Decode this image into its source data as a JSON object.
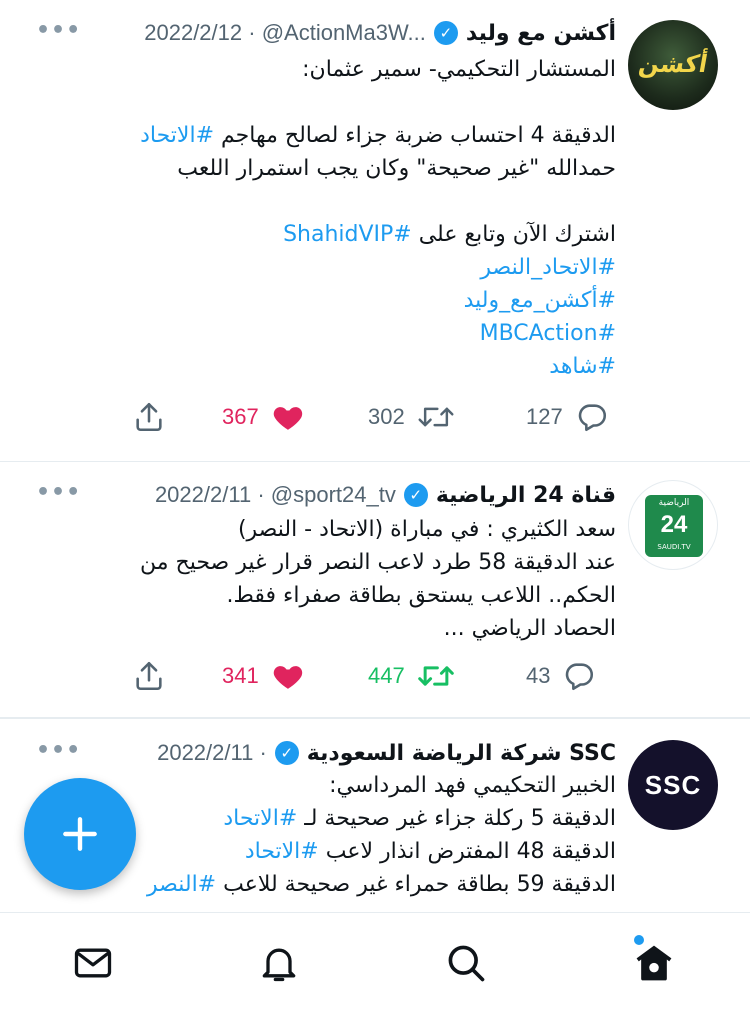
{
  "feed": {
    "tweets": [
      {
        "author": "أكشن مع وليد",
        "handle": "@ActionMa3W...",
        "date": "2022/2/12",
        "separator": "·",
        "more": "•••",
        "body": {
          "l1": "المستشار التحكيمي- سمير عثمان:",
          "l2_text": "الدقيقة 4 احتساب ضربة جزاء لصالح مهاجم",
          "l2_tag": "#الاتحاد",
          "l3": "حمدالله \"غير صحيحة\" وكان يجب استمرار اللعب",
          "l4_text": "اشترك الآن وتابع على",
          "l4_tag": "#ShahidVIP",
          "tag1": "#الاتحاد_النصر",
          "tag2": "#أكشن_مع_وليد",
          "tag3": "#MBCAction",
          "tag4": "#شاهد"
        },
        "stats": {
          "replies": "127",
          "retweets": "302",
          "likes": "367"
        },
        "avatar_logo": "أكشن"
      },
      {
        "author": "قناة 24 الرياضية",
        "handle": "@sport24_tv",
        "date": "2022/2/11",
        "separator": "·",
        "more": "•••",
        "body": {
          "l1": "سعد الكثيري : في مباراة (الاتحاد - النصر)",
          "l2": "عند الدقيقة 58 طرد لاعب النصر قرار غير صحيح من",
          "l3": "الحكم.. اللاعب يستحق بطاقة صفراء فقط.",
          "l4": "الحصاد الرياضي ..."
        },
        "stats": {
          "replies": "43",
          "retweets": "447",
          "likes": "341"
        },
        "avatar_top": "الرياضية",
        "avatar_num": "24",
        "avatar_sub": "SAUDI.TV"
      },
      {
        "author": "شركة الرياضة السعودية SSC",
        "handle": "",
        "date": "2022/2/11",
        "separator": "·",
        "more": "•••",
        "body": {
          "l1": "الخبير التحكيمي فهد المرداسي:",
          "l2_text": "الدقيقة 5 ركلة جزاء غير صحيحة لـ",
          "l2_tag": "#الاتحاد",
          "l3_text": "الدقيقة 48 المفترض انذار لاعب",
          "l3_tag": "#الاتحاد",
          "l4_text": "الدقيقة 59 بطاقة حمراء غير صحيحة للاعب",
          "l4_tag": "#النصر"
        },
        "avatar_logo": "SSC"
      }
    ]
  },
  "icons": {
    "verified": "verified-badge-icon",
    "reply": "reply-icon",
    "retweet": "retweet-icon",
    "like": "heart-icon",
    "share": "share-icon",
    "compose": "compose-plus-icon",
    "messages": "mail-icon",
    "notifications": "bell-icon",
    "search": "search-icon",
    "home": "home-icon"
  },
  "colors": {
    "accent": "#1d9bf0",
    "like": "#e0245e",
    "retweet_active": "#17bf63",
    "muted": "#536471"
  }
}
